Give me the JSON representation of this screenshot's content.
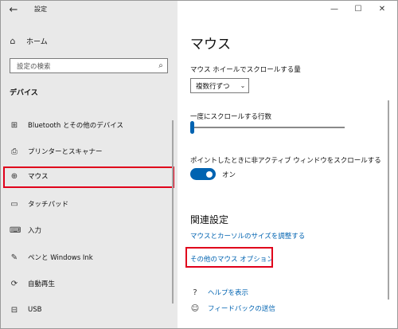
{
  "window": {
    "title": "設定",
    "back_icon": "←",
    "controls": {
      "minimize": "—",
      "maximize": "☐",
      "close": "✕"
    }
  },
  "sidebar": {
    "home": {
      "icon": "⌂",
      "label": "ホーム"
    },
    "search": {
      "placeholder": "設定の検索",
      "icon": "⌕"
    },
    "section_title": "デバイス",
    "items": [
      {
        "icon": "⊞",
        "label": "Bluetooth とその他のデバイス"
      },
      {
        "icon": "⎙",
        "label": "プリンターとスキャナー"
      },
      {
        "icon": "⊕",
        "label": "マウス",
        "selected": true
      },
      {
        "icon": "▭",
        "label": "タッチパッド"
      },
      {
        "icon": "⌨",
        "label": "入力"
      },
      {
        "icon": "✎",
        "label": "ペンと Windows Ink"
      },
      {
        "icon": "⟳",
        "label": "自動再生"
      },
      {
        "icon": "⊟",
        "label": "USB"
      }
    ]
  },
  "main": {
    "title": "マウス",
    "wheel_label": "マウス ホイールでスクロールする量",
    "wheel_select": {
      "value": "複数行ずつ",
      "icon": "⌄"
    },
    "lines_label": "一度にスクロールする行数",
    "lines_slider_fraction": 0.0,
    "inactive_label": "ポイントしたときに非アクティブ ウィンドウをスクロールする",
    "inactive_toggle": {
      "on": true,
      "text": "オン"
    },
    "related_title": "関連設定",
    "link_size": "マウスとカーソルのサイズを調整する",
    "link_other": "その他のマウス オプション",
    "help": {
      "icon": "?",
      "label": "ヘルプを表示"
    },
    "feedback": {
      "icon": "☺",
      "label": "フィードバックの送信"
    }
  },
  "colors": {
    "accent": "#0063b1",
    "highlight": "#e0001b",
    "sidebar_bg": "#e9e9e9"
  }
}
